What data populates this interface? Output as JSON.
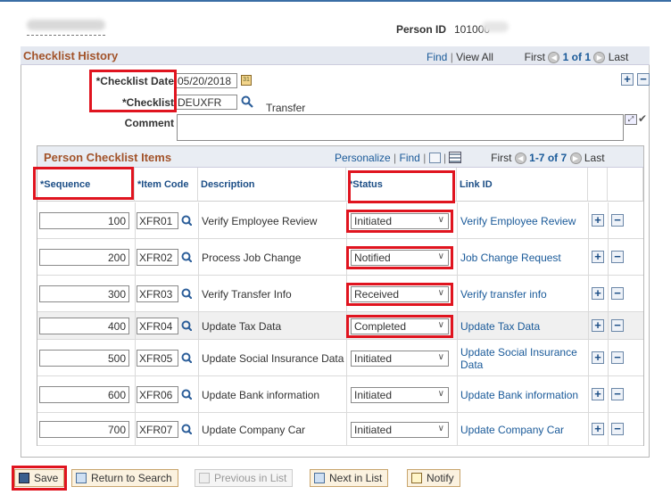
{
  "header": {
    "person_id_label": "Person ID",
    "person_id_value": "101000"
  },
  "history": {
    "title": "Checklist History",
    "find": "Find",
    "view_all": "View All",
    "first": "First",
    "page": "1 of 1",
    "last": "Last"
  },
  "form": {
    "checklist_date_label": "*Checklist Date",
    "checklist_date": "05/20/2018",
    "checklist_label": "*Checklist",
    "checklist": "DEUXFR",
    "checklist_desc": "Transfer",
    "comment_label": "Comment",
    "comment": ""
  },
  "grid": {
    "title": "Person Checklist Items",
    "personalize": "Personalize",
    "find": "Find",
    "first": "First",
    "page": "1-7 of 7",
    "last": "Last",
    "columns": {
      "sequence": "*Sequence",
      "item_code": "*Item Code",
      "description": "Description",
      "status": "*Status",
      "link_id": "Link ID"
    },
    "rows": [
      {
        "seq": "100",
        "code": "XFR01",
        "desc": "Verify Employee Review",
        "status": "Initiated",
        "link": "Verify Employee Review"
      },
      {
        "seq": "200",
        "code": "XFR02",
        "desc": "Process Job Change",
        "status": "Notified",
        "link": "Job Change Request"
      },
      {
        "seq": "300",
        "code": "XFR03",
        "desc": "Verify Transfer Info",
        "status": "Received",
        "link": "Verify transfer info"
      },
      {
        "seq": "400",
        "code": "XFR04",
        "desc": "Update Tax Data",
        "status": "Completed",
        "link": "Update Tax Data"
      },
      {
        "seq": "500",
        "code": "XFR05",
        "desc": "Update Social Insurance Data",
        "status": "Initiated",
        "link": "Update Social Insurance Data"
      },
      {
        "seq": "600",
        "code": "XFR06",
        "desc": "Update Bank information",
        "status": "Initiated",
        "link": "Update Bank information"
      },
      {
        "seq": "700",
        "code": "XFR07",
        "desc": "Update Company Car",
        "status": "Initiated",
        "link": "Update Company Car"
      }
    ]
  },
  "toolbar": {
    "save": "Save",
    "return": "Return to Search",
    "previous": "Previous in List",
    "next": "Next in List",
    "notify": "Notify"
  },
  "colors": {
    "title": "#a2532a",
    "link": "#1a5a99",
    "highlight": "#e0141f"
  }
}
